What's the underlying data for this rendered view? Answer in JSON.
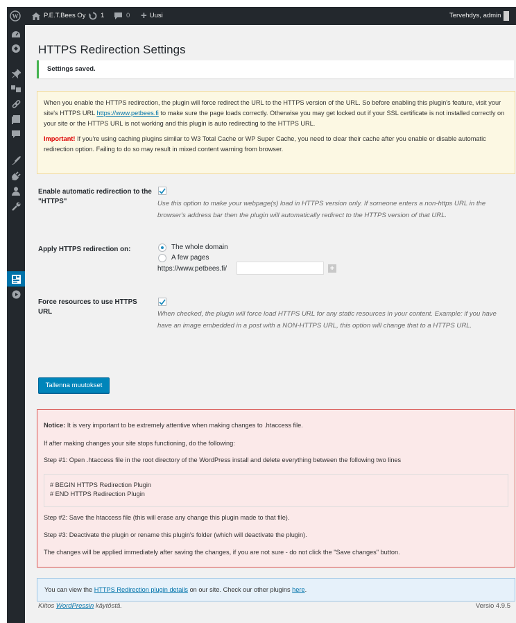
{
  "adminbar": {
    "site_name": "P.E.T.Bees Oy",
    "updates_count": "1",
    "comments_count": "0",
    "new_label": "Uusi",
    "greeting": "Tervehdys, admin"
  },
  "page": {
    "title": "HTTPS Redirection Settings",
    "saved_notice": "Settings saved."
  },
  "warning": {
    "p1_before": "When you enable the HTTPS redirection, the plugin will force redirect the URL to the HTTPS version of the URL. So before enabling this plugin's feature, visit your site's HTTPS URL ",
    "p1_link": "https://www.petbees.fi",
    "p1_after": " to make sure the page loads correctly. Otherwise you may get locked out if your SSL certificate is not installed correctly on your site or the HTTPS URL is not working and this plugin is auto redirecting to the HTTPS URL.",
    "important_label": "Important!",
    "p2_text": " If you're using caching plugins similar to W3 Total Cache or WP Super Cache, you need to clear their cache after you enable or disable automatic redirection option. Failing to do so may result in mixed content warning from browser."
  },
  "settings": {
    "auto_redirect_label": "Enable automatic redirection to the \"HTTPS\"",
    "auto_redirect_checked": true,
    "auto_redirect_desc": "Use this option to make your webpage(s) load in HTTPS version only. If someone enters a non-https URL in the browser's address bar then the plugin will automatically redirect to the HTTPS version of that URL.",
    "apply_label": "Apply HTTPS redirection on:",
    "radio_whole": "The whole domain",
    "radio_few": "A few pages",
    "radio_selected": "whole",
    "url_prefix": "https://www.petbees.fi/",
    "url_value": "",
    "force_label": "Force resources to use HTTPS URL",
    "force_checked": true,
    "force_desc": "When checked, the plugin will force load HTTPS URL for any static resources in your content. Example: if you have have an image embedded in a post with a NON-HTTPS URL, this option will change that to a HTTPS URL."
  },
  "save_button": "Tallenna muutokset",
  "htaccess": {
    "notice_label": "Notice:",
    "notice_text": " It is very important to be extremely attentive when making changes to .htaccess file.",
    "line2": "If after making changes your site stops functioning, do the following:",
    "step1": "Step #1: Open .htaccess file in the root directory of the WordPress install and delete everything between the following two lines",
    "code_begin": "# BEGIN HTTPS Redirection Plugin",
    "code_end": "# END HTTPS Redirection Plugin",
    "step2": "Step #2: Save the htaccess file (this will erase any change this plugin made to that file).",
    "step3": "Step #3: Deactivate the plugin or rename this plugin's folder (which will deactivate the plugin).",
    "final": "The changes will be applied immediately after saving the changes, if you are not sure - do not click the \"Save changes\" button."
  },
  "info": {
    "before": "You can view the ",
    "link1": "HTTPS Redirection plugin details",
    "middle": " on our site. Check our other plugins ",
    "link2": "here",
    "after": "."
  },
  "footer": {
    "thanks_before": "Kiitos ",
    "thanks_link": "WordPressin",
    "thanks_after": " käytöstä.",
    "version": "Versio 4.9.5"
  },
  "colors": {
    "adminbar_bg": "#23282d",
    "accent": "#0073aa",
    "button": "#0085ba",
    "success": "#46b450",
    "danger": "#d9534f"
  }
}
